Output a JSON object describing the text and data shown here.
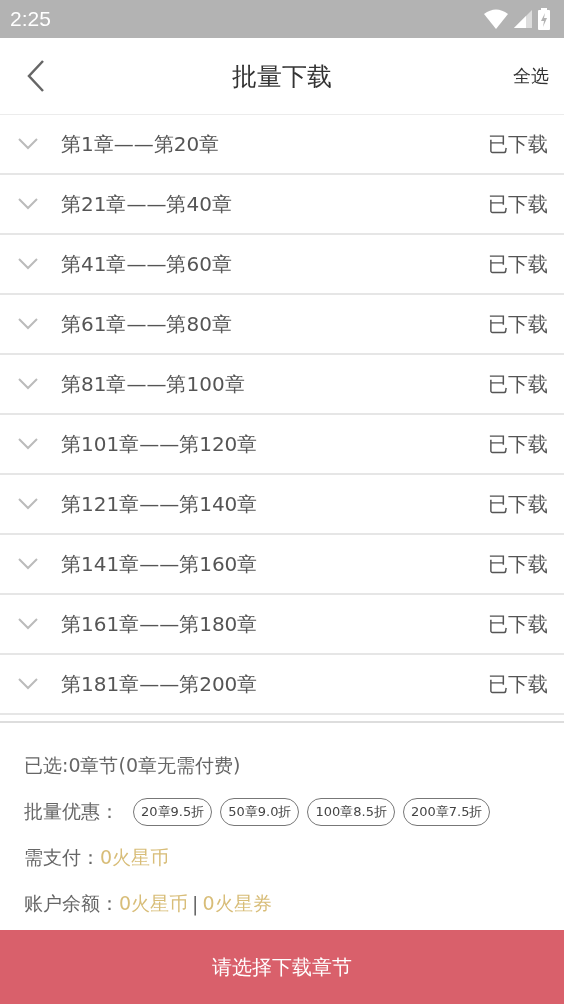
{
  "status_bar": {
    "time": "2:25"
  },
  "header": {
    "title": "批量下载",
    "action": "全选"
  },
  "chapters": [
    {
      "label": "第1章——第20章",
      "status": "已下载",
      "expanded": false
    },
    {
      "label": "第21章——第40章",
      "status": "已下载",
      "expanded": false
    },
    {
      "label": "第41章——第60章",
      "status": "已下载",
      "expanded": false
    },
    {
      "label": "第61章——第80章",
      "status": "已下载",
      "expanded": false
    },
    {
      "label": "第81章——第100章",
      "status": "已下载",
      "expanded": false
    },
    {
      "label": "第101章——第120章",
      "status": "已下载",
      "expanded": false
    },
    {
      "label": "第121章——第140章",
      "status": "已下载",
      "expanded": false
    },
    {
      "label": "第141章——第160章",
      "status": "已下载",
      "expanded": false
    },
    {
      "label": "第161章——第180章",
      "status": "已下载",
      "expanded": false
    },
    {
      "label": "第181章——第200章",
      "status": "已下载",
      "expanded": false
    }
  ],
  "summary": {
    "selected": "已选:0章节(0章无需付费)",
    "discount_label": "批量优惠：",
    "discounts": [
      "20章9.5折",
      "50章9.0折",
      "100章8.5折",
      "200章7.5折"
    ],
    "pay_label": "需支付：",
    "pay_value": "0火星币",
    "balance_label": "账户余额：",
    "balance_values": [
      "0火星币",
      "0火星券"
    ],
    "balance_separator": "|"
  },
  "download_button": "请选择下载章节"
}
